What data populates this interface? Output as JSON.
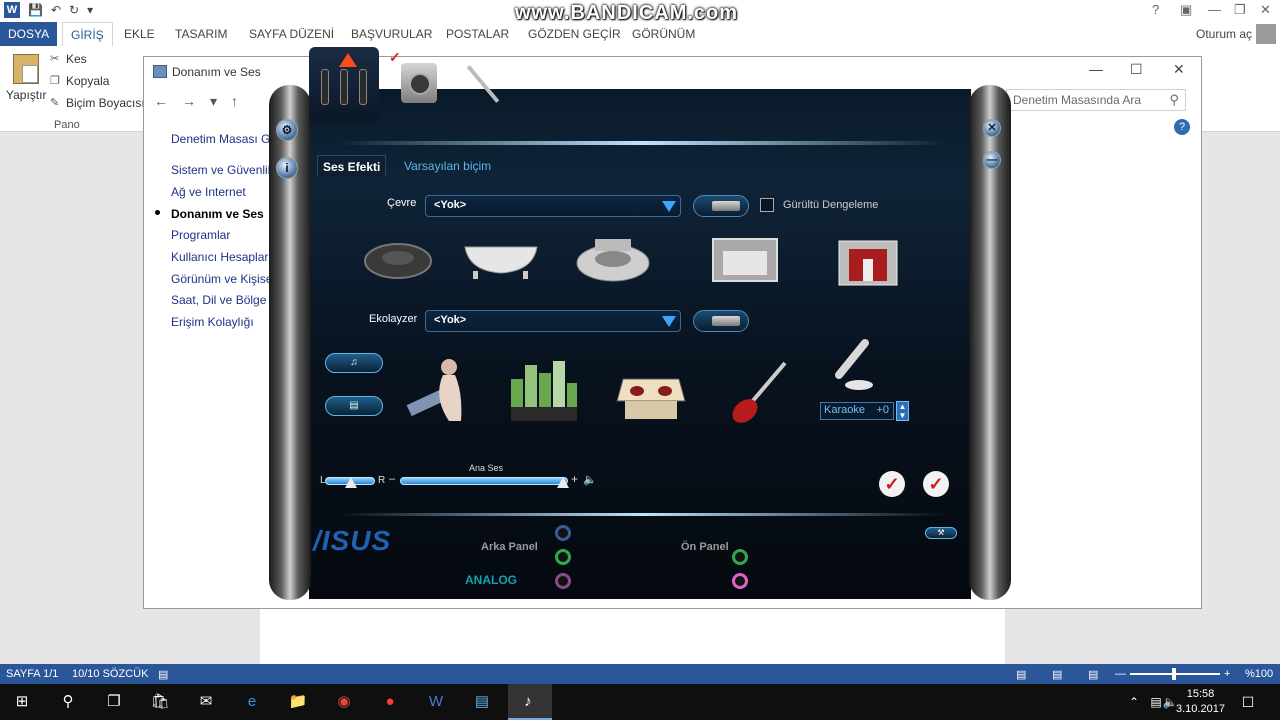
{
  "word": {
    "tabs": [
      "DOSYA",
      "GİRİŞ",
      "EKLE",
      "TASARIM",
      "SAYFA DÜZENİ",
      "BAŞVURULAR",
      "POSTALAR",
      "GÖZDEN GEÇİR",
      "GÖRÜNÜM"
    ],
    "signin": "Oturum aç",
    "watermark": "www.BANDICAM.com",
    "clipboard": {
      "paste": "Yapıştır",
      "cut": "Kes",
      "copy": "Kopyala",
      "format_painter": "Biçim Boyacısı",
      "group": "Pano"
    },
    "status": {
      "page": "SAYFA 1/1",
      "words": "10/10 SÖZCÜK",
      "zoom": "%100"
    },
    "colors": {
      "accent": "#2b579a"
    }
  },
  "control_panel": {
    "title": "Donanım ve Ses",
    "search_placeholder": "Denetim Masasında Ara",
    "sidebar": [
      "Denetim Masası Giriş",
      "Sistem ve Güvenlik",
      "Ağ ve Internet",
      "Donanım ve Ses",
      "Programlar",
      "Kullanıcı Hesapları",
      "Görünüm ve Kişisell",
      "Saat, Dil ve Bölge",
      "Erişim Kolaylığı"
    ]
  },
  "asus_panel": {
    "tabs": [
      "Ses Efekti",
      "Varsayılan biçim"
    ],
    "environment_label": "Çevre",
    "environment_value": "<Yok>",
    "noise_label": "Gürültü Dengeleme",
    "equalizer_label": "Ekolayzer",
    "equalizer_value": "<Yok>",
    "karaoke_label": "Karaoke",
    "karaoke_value": "+0",
    "master_volume": "Ana Ses",
    "left": "L",
    "right": "R",
    "minus": "–",
    "plus": "+",
    "logo": "/ISUS",
    "back_panel": "Arka Panel",
    "front_panel": "Ön Panel",
    "analog": "ANALOG",
    "colors": {
      "accent": "#3aa6ff",
      "brand": "#1f62b3",
      "analog": "#0fa2b7"
    }
  },
  "taskbar": {
    "time": "15:58",
    "date": "3.10.2017"
  }
}
